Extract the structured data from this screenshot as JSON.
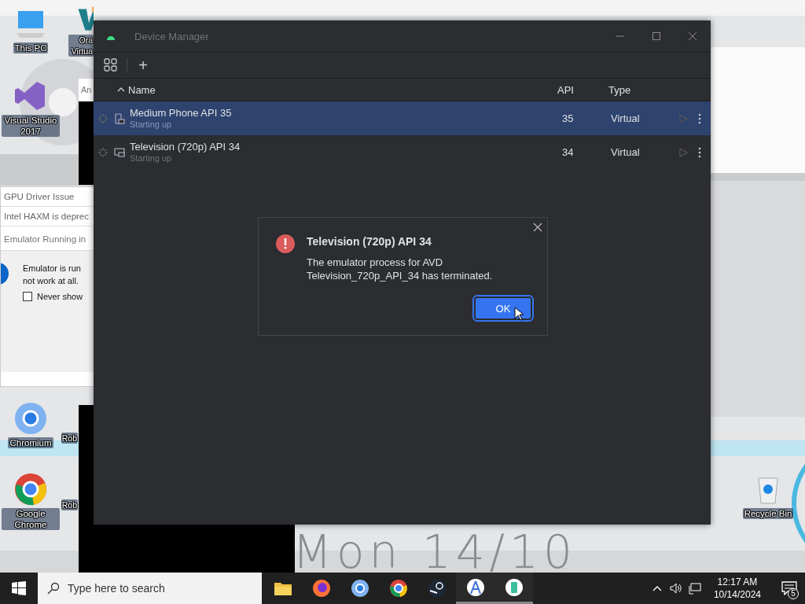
{
  "desktop": {
    "icons": [
      {
        "label": "This PC",
        "kind": "pc"
      },
      {
        "label": "Ora Virtua",
        "kind": "vbox"
      },
      {
        "label": "Visual Studio 2017",
        "kind": "vs"
      },
      {
        "label": "Chromium",
        "kind": "chromium"
      },
      {
        "label": "Rob",
        "kind": "rob"
      },
      {
        "label": "Google Chrome",
        "kind": "chrome"
      },
      {
        "label": "Rob",
        "kind": "rob"
      },
      {
        "label": "Recycle Bin",
        "kind": "bin"
      }
    ],
    "widget": {
      "text": "Mon 14/10"
    }
  },
  "background_windows": {
    "partial_window": {
      "title": "An"
    },
    "notifications": {
      "items": [
        {
          "text": "GPU Driver Issue"
        },
        {
          "text": "Intel HAXM is deprec"
        }
      ]
    },
    "emulator_dialog": {
      "title": "Emulator Running in",
      "message": [
        "Emulator is run",
        "not work at all."
      ],
      "checkbox": {
        "label": "Never show",
        "checked": false
      }
    }
  },
  "device_manager": {
    "window": {
      "title": "Device Manager"
    },
    "toolbar": {
      "add": "+"
    },
    "table": {
      "columns": [
        {
          "label": "Name",
          "sorted": true
        },
        {
          "label": "API",
          "sorted": false
        },
        {
          "label": "Type",
          "sorted": false
        }
      ],
      "rows": [
        {
          "name": "Medium Phone API 35",
          "status": "Starting up",
          "api": "35",
          "type": "Virtual",
          "kind": "phone",
          "selected": true
        },
        {
          "name": "Television (720p) API 34",
          "status": "Starting up",
          "api": "34",
          "type": "Virtual",
          "kind": "tv",
          "selected": false
        }
      ]
    }
  },
  "dialog": {
    "title": "Television (720p) API 34",
    "kind": "error",
    "message": [
      "The emulator process for AVD",
      "Television_720p_API_34 has terminated."
    ],
    "button": "OK"
  },
  "taskbar": {
    "search": {
      "placeholder": "Type here to search"
    },
    "apps": [
      {
        "kind": "folder",
        "running": false
      },
      {
        "kind": "firefox",
        "running": false
      },
      {
        "kind": "chromium",
        "running": false
      },
      {
        "kind": "chrome",
        "running": false
      },
      {
        "kind": "steam",
        "running": false
      },
      {
        "kind": "studio",
        "running": true
      },
      {
        "kind": "emulator",
        "running": true
      }
    ],
    "clock": {
      "time": "12:17 AM",
      "date": "10/14/2024"
    },
    "notifications": {
      "count": "5"
    }
  }
}
